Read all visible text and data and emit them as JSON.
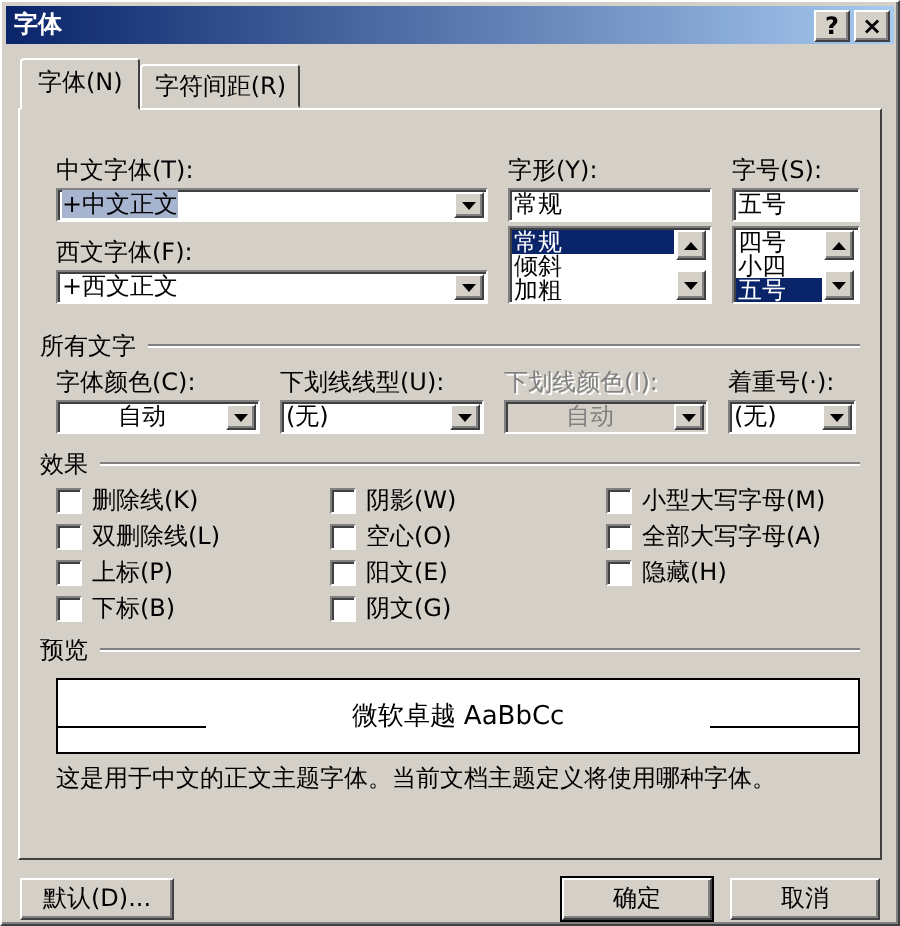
{
  "window": {
    "title": "字体",
    "help": "?",
    "close": "×"
  },
  "tabs": [
    {
      "label": "字体(N)",
      "selected": true
    },
    {
      "label": "字符间距(R)",
      "selected": false
    }
  ],
  "font_fields": [
    {
      "label": "中文字体(T):",
      "value": "+中文正文",
      "highlighted": true
    },
    {
      "label": "西文字体(F):",
      "value": "+西文正文",
      "highlighted": false
    }
  ],
  "style": {
    "label": "字形(Y):",
    "value": "常规",
    "options": [
      {
        "label": "常规",
        "selected": true
      },
      {
        "label": "倾斜",
        "selected": false
      },
      {
        "label": "加粗",
        "selected": false
      }
    ]
  },
  "size": {
    "label": "字号(S):",
    "value": "五号",
    "options": [
      {
        "label": "四号",
        "selected": false
      },
      {
        "label": "小四",
        "selected": false
      },
      {
        "label": "五号",
        "selected": true
      }
    ]
  },
  "all_text": {
    "title": "所有文字",
    "dropdowns": [
      {
        "label": "字体颜色(C):",
        "value": "自动",
        "disabled": false,
        "centered": true
      },
      {
        "label": "下划线线型(U):",
        "value": "(无)",
        "disabled": false,
        "centered": false
      },
      {
        "label": "下划线颜色(I):",
        "value": "自动",
        "disabled": true,
        "centered": true
      },
      {
        "label": "着重号(·):",
        "value": "(无)",
        "disabled": false,
        "centered": false
      }
    ]
  },
  "effects": {
    "title": "效果",
    "columns": [
      [
        {
          "label": "删除线(K)",
          "checked": false
        },
        {
          "label": "双删除线(L)",
          "checked": false
        },
        {
          "label": "上标(P)",
          "checked": false
        },
        {
          "label": "下标(B)",
          "checked": false
        }
      ],
      [
        {
          "label": "阴影(W)",
          "checked": false
        },
        {
          "label": "空心(O)",
          "checked": false
        },
        {
          "label": "阳文(E)",
          "checked": false
        },
        {
          "label": "阴文(G)",
          "checked": false
        }
      ],
      [
        {
          "label": "小型大写字母(M)",
          "checked": false
        },
        {
          "label": "全部大写字母(A)",
          "checked": false
        },
        {
          "label": "隐藏(H)",
          "checked": false
        }
      ]
    ]
  },
  "preview": {
    "title": "预览",
    "sample": "微软卓越 AaBbCc",
    "note": "这是用于中文的正文主题字体。当前文档主题定义将使用哪种字体。"
  },
  "buttons": [
    {
      "label": "默认(D)...",
      "default": false
    },
    {
      "label": "确定",
      "default": true
    },
    {
      "label": "取消",
      "default": false
    }
  ]
}
